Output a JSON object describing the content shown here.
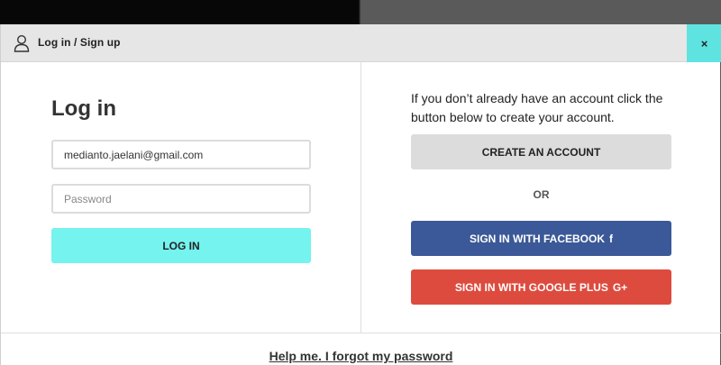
{
  "header": {
    "title": "Log in / Sign up",
    "icon": "user-icon",
    "close_label": "×",
    "accent": "#5ee3e0"
  },
  "login": {
    "heading": "Log in",
    "email_value": "medianto.jaelani@gmail.com",
    "password_placeholder": "Password",
    "button_label": "LOG IN",
    "button_color": "#74f3ef"
  },
  "signup": {
    "description": "If you don’t already have an account click the button below to create your account.",
    "create_label": "CREATE AN ACCOUNT",
    "or_label": "OR",
    "facebook_label": "SIGN IN WITH FACEBOOK",
    "facebook_glyph": "f",
    "facebook_color": "#3b5998",
    "google_label": "SIGN IN WITH GOOGLE PLUS",
    "google_glyph": "G+",
    "google_color": "#dd4b3f"
  },
  "footer": {
    "forgot_label": "Help me. I forgot my password"
  }
}
